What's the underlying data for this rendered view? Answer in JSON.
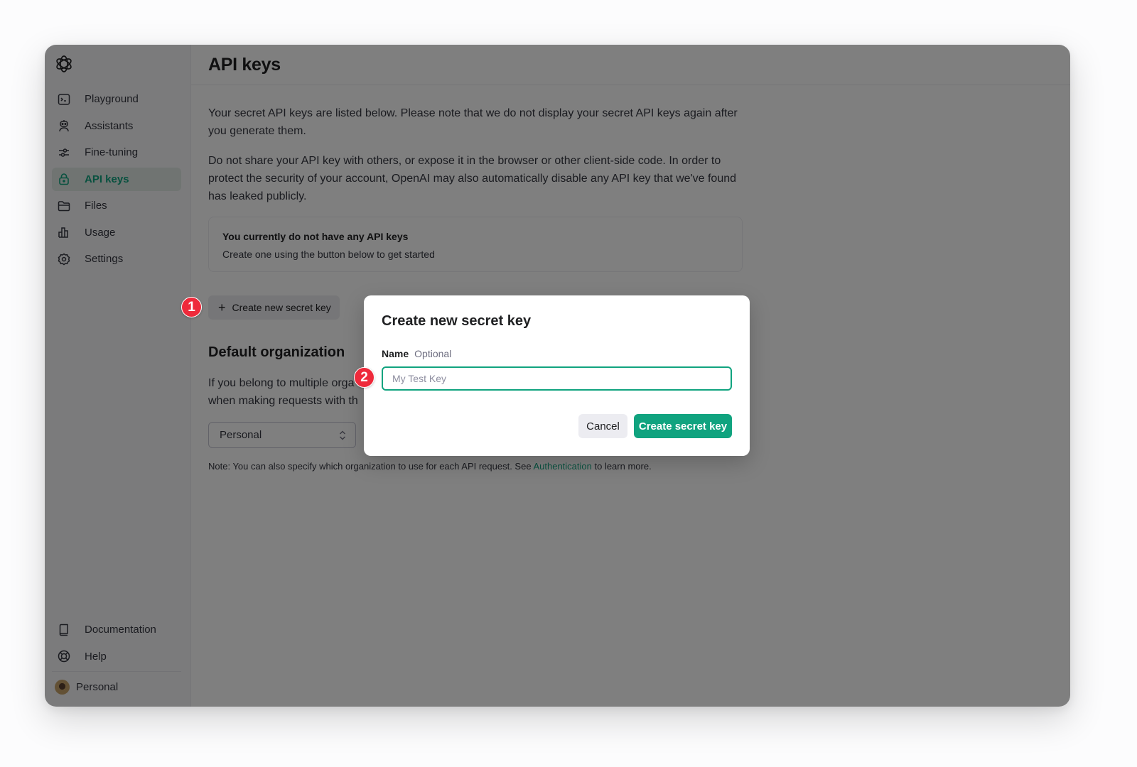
{
  "sidebar": {
    "logo": "openai-logo",
    "items": [
      {
        "label": "Playground",
        "icon": "terminal-icon",
        "active": false
      },
      {
        "label": "Assistants",
        "icon": "robot-icon",
        "active": false
      },
      {
        "label": "Fine-tuning",
        "icon": "sliders-icon",
        "active": false
      },
      {
        "label": "API keys",
        "icon": "lock-icon",
        "active": true
      },
      {
        "label": "Files",
        "icon": "folder-icon",
        "active": false
      },
      {
        "label": "Usage",
        "icon": "bar-chart-icon",
        "active": false
      },
      {
        "label": "Settings",
        "icon": "gear-icon",
        "active": false
      }
    ],
    "bottom_items": [
      {
        "label": "Documentation",
        "icon": "book-icon"
      },
      {
        "label": "Help",
        "icon": "lifebuoy-icon"
      }
    ],
    "account": {
      "label": "Personal"
    }
  },
  "header": {
    "title": "API keys"
  },
  "main": {
    "intro_paragraph": "Your secret API keys are listed below. Please note that we do not display your secret API keys again after you generate them.",
    "warning_paragraph": "Do not share your API key with others, or expose it in the browser or other client-side code. In order to protect the security of your account, OpenAI may also automatically disable any API key that we've found has leaked publicly.",
    "empty_state": {
      "title": "You currently do not have any API keys",
      "subtitle": "Create one using the button below to get started"
    },
    "create_button": {
      "icon": "+",
      "label": "Create new secret key"
    },
    "default_org": {
      "title": "Default organization",
      "paragraph_visible_line1": "If you belong to multiple orga",
      "paragraph_visible_line2": "when making requests with th",
      "selected": "Personal",
      "note_prefix": "Note: You can also specify which organization to use for each API request. See ",
      "note_link": "Authentication",
      "note_suffix": " to learn more."
    }
  },
  "annotations": [
    {
      "number": "1"
    },
    {
      "number": "2"
    }
  ],
  "dialog": {
    "title": "Create new secret key",
    "field_label": "Name",
    "field_hint": "Optional",
    "input_value": "",
    "input_placeholder": "My Test Key",
    "cancel_label": "Cancel",
    "submit_label": "Create secret key"
  },
  "colors": {
    "accent": "#10a37f",
    "badge": "#ee2a3b"
  }
}
